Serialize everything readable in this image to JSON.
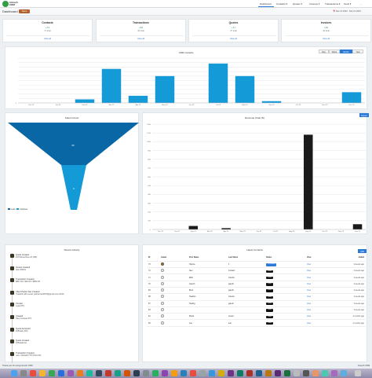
{
  "nav": {
    "logo_line1": "Intouch",
    "logo_line2": "CRM",
    "items": [
      {
        "label": "Dashboard"
      },
      {
        "label": "Contacts ▾"
      },
      {
        "label": "Quotes ▾"
      },
      {
        "label": "Invoices ▾"
      },
      {
        "label": "Transactions ▾"
      },
      {
        "label": "Tools ▾"
      },
      {
        "label": "…"
      }
    ]
  },
  "subbar": {
    "title": "Dashboard",
    "save_label": "Save",
    "date_range": "📅 Dec 21 2022 - Dec 21 2023"
  },
  "cards": [
    {
      "title": "Contacts",
      "value": "+71",
      "sub": "71 total",
      "link": "View all"
    },
    {
      "title": "Transactions",
      "value": "+42",
      "sub": "42 total",
      "link": "View all"
    },
    {
      "title": "Quotes",
      "value": "+17",
      "sub": "17 total",
      "link": "View all"
    },
    {
      "title": "Invoices",
      "value": "+42",
      "sub": "42 total",
      "link": "View all"
    }
  ],
  "crm_chart": {
    "title": "CRM contacts",
    "range_buttons": [
      "Day",
      "Week",
      "Month",
      "Year"
    ],
    "active_range": "Month"
  },
  "funnel": {
    "title": "Sales Funnel",
    "top_value": "65",
    "bottom_value": "6",
    "legend": [
      {
        "label": "Lead",
        "color": "#0a67a6"
      },
      {
        "label": "Customer",
        "color": "#149bd7"
      }
    ]
  },
  "revenue": {
    "title": "Revenue Chart ($)",
    "export_label": "Export"
  },
  "chart_data": [
    {
      "type": "bar",
      "title": "CRM contacts",
      "categories": [
        "Dec 22",
        "Jan 23",
        "Feb 23",
        "Mar 23",
        "Apr 23",
        "May 23",
        "Jun 23",
        "Jul 23",
        "Aug 23",
        "Sep 23",
        "Oct 23",
        "Nov 23",
        "Dec 23"
      ],
      "values": [
        0,
        0,
        2,
        19,
        4,
        15,
        0,
        22,
        15,
        1,
        0,
        0,
        6
      ],
      "ylim": [
        0,
        25
      ],
      "yticks": [
        "0",
        "",
        "",
        "",
        "",
        "",
        "",
        "",
        "",
        "",
        ""
      ],
      "color": "#149bd7",
      "grid": true
    },
    {
      "type": "bar",
      "title": "Revenue Chart ($)",
      "categories": [
        "Dec 22",
        "Jan 23",
        "Feb 23",
        "Mar 23",
        "Apr 23",
        "May 23",
        "Jun 23",
        "Jul 23",
        "Aug 23",
        "Sep 23",
        "Oct 23",
        "Nov 23",
        "Dec 23"
      ],
      "values": [
        0,
        0,
        40,
        0,
        15,
        0,
        0,
        0,
        0,
        1080,
        0,
        0,
        60
      ],
      "ylim": [
        0,
        1200
      ],
      "yticks": [
        "0",
        "100",
        "200",
        "300",
        "400",
        "500",
        "600",
        "700",
        "800",
        "900",
        "1000",
        "1100",
        "1200"
      ],
      "color": "#1a1a1a",
      "grid": true
    }
  ],
  "activity": {
    "title": "Recent Activity",
    "items": [
      {
        "text": "Quote Created",
        "sub": "#17/StreetView 24 (f25)",
        "time": "···"
      },
      {
        "text": "Invoice Created",
        "sub": "Item #0001",
        "time": "···"
      },
      {
        "text": "Transaction Created",
        "sub": "$847.00 / $91.00 / $852.00",
        "time": "···"
      },
      {
        "text": "Client Portal User Created",
        "sub": "Created with email: patrick.lee0879@gmail.com #313",
        "time": "···"
      },
      {
        "text": "Contact",
        "sub": "Lead #79",
        "time": "···"
      },
      {
        "text": "Created",
        "sub": "New Contact #73",
        "time": "···"
      },
      {
        "text": "Quote Accepted",
        "sub": "#15/aaa (f10)",
        "time": "···"
      },
      {
        "text": "Quote Created",
        "sub": "#15/aaa/ma",
        "time": "···"
      },
      {
        "text": "Transaction Created",
        "sub": "new: 220/ad/7778 (5x12.00)",
        "time": "···"
      }
    ]
  },
  "latest": {
    "title": "Latest Contacts",
    "add_label": "Add",
    "columns": [
      "ID",
      "Avatar",
      "First Name",
      "Last Name",
      "Status",
      "View",
      "Added"
    ],
    "rows": [
      {
        "id": "73",
        "first": "Hannie",
        "last": "li",
        "status": "Customer",
        "view": "View",
        "added": "2 weeks ago"
      },
      {
        "id": "72",
        "first": "Alec",
        "last": "Contact",
        "status": "Lead",
        "view": "View",
        "added": "2 weeks ago"
      },
      {
        "id": "71",
        "first": "ERA",
        "last": "Ginetto",
        "status": "Lead",
        "view": "View",
        "added": "2 weeks ago"
      },
      {
        "id": "70",
        "first": "Gareth",
        "last": "gareth",
        "status": "Lead",
        "view": "View",
        "added": "2 weeks ago"
      },
      {
        "id": "69",
        "first": "Brett",
        "last": "gareth",
        "status": "Lead",
        "view": "View",
        "added": "2 weeks ago"
      },
      {
        "id": "68",
        "first": "Heather",
        "last": "Ginetto",
        "status": "Lead",
        "view": "View",
        "added": "2 weeks ago"
      },
      {
        "id": "67",
        "first": "Tasting",
        "last": "gareth",
        "status": "Lead",
        "view": "View",
        "added": "3 weeks ago"
      },
      {
        "id": "63",
        "first": "",
        "last": "",
        "status": "Lead",
        "view": "View",
        "added": "3 weeks ago"
      },
      {
        "id": "61",
        "first": "Plaza",
        "last": "Lhotel",
        "status": "Lead",
        "view": "View",
        "added": "4 months ago"
      },
      {
        "id": "60",
        "first": "Joe",
        "last": "test",
        "status": "Lead",
        "view": "View",
        "added": "4 months ago"
      }
    ]
  },
  "footer": {
    "left": "Thank you for using Intouch CRM",
    "right": "Intouch CRM"
  }
}
